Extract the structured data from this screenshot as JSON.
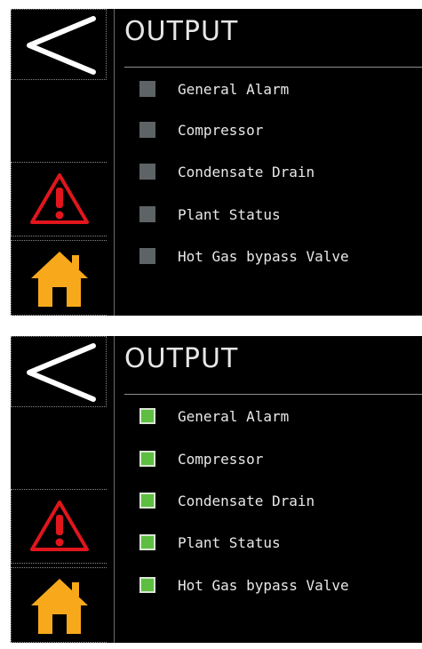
{
  "screens": [
    {
      "title": "OUTPUT",
      "state": "off",
      "outputs": [
        {
          "label": "General Alarm",
          "active": false
        },
        {
          "label": "Compressor",
          "active": false
        },
        {
          "label": "Condensate Drain",
          "active": false
        },
        {
          "label": "Plant Status",
          "active": false
        },
        {
          "label": "Hot Gas bypass Valve",
          "active": false
        }
      ]
    },
    {
      "title": "OUTPUT",
      "state": "on",
      "outputs": [
        {
          "label": "General Alarm",
          "active": true
        },
        {
          "label": "Compressor",
          "active": true
        },
        {
          "label": "Condensate Drain",
          "active": true
        },
        {
          "label": "Plant Status",
          "active": true
        },
        {
          "label": "Hot Gas bypass Valve",
          "active": true
        }
      ]
    }
  ],
  "colors": {
    "indicator_off": "#5e6466",
    "indicator_on": "#5dbe41",
    "alarm_red": "#e0161c",
    "home_orange": "#f7a81b",
    "background": "#000000"
  },
  "icons": {
    "back": "chevron-left-icon",
    "alarm": "warning-triangle-icon",
    "home": "home-icon"
  }
}
